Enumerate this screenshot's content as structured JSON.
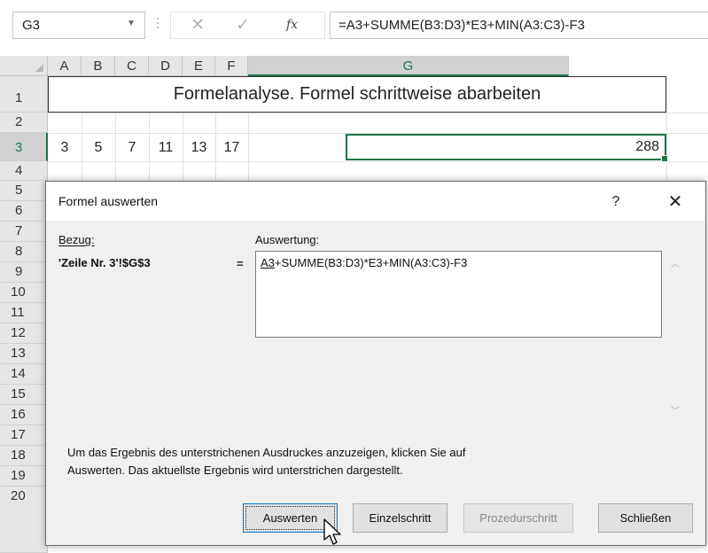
{
  "formula_bar": {
    "name_box": "G3",
    "formula": "=A3+SUMME(B3:D3)*E3+MIN(A3:C3)-F3",
    "cancel_glyph": "✕",
    "enter_glyph": "✓",
    "fx_label": "fx"
  },
  "grid": {
    "columns": [
      "A",
      "B",
      "C",
      "D",
      "E",
      "F",
      "G"
    ],
    "rows": [
      "1",
      "2",
      "3",
      "4",
      "5",
      "6",
      "7",
      "8",
      "9",
      "10",
      "11",
      "12",
      "13",
      "14",
      "15",
      "16",
      "17",
      "18",
      "19",
      "20"
    ],
    "title": "Formelanalyse.  Formel schrittweise abarbeiten",
    "row3_values": [
      "3",
      "5",
      "7",
      "11",
      "13",
      "17"
    ],
    "g3_value": "288",
    "selected_cell": "G3"
  },
  "dialog": {
    "title": "Formel auswerten",
    "help_glyph": "?",
    "close_glyph": "✕",
    "bezug_label": "Bezug:",
    "bezug_value": "'Zeile Nr. 3'!$G$3",
    "equals": "=",
    "auswertung_label": "Auswertung:",
    "expression_underlined": "A3",
    "expression_rest": "+SUMME(B3:D3)*E3+MIN(A3:C3)-F3",
    "hint_line1": "Um das Ergebnis des unterstrichenen Ausdruckes anzuzeigen, klicken Sie auf",
    "hint_line2": "Auswerten. Das aktuellste Ergebnis wird unterstrichen dargestellt.",
    "buttons": {
      "auswerten": "Auswerten",
      "einzelschritt": "Einzelschritt",
      "prozedurschritt": "Prozedurschritt",
      "schliessen": "Schließen"
    }
  }
}
